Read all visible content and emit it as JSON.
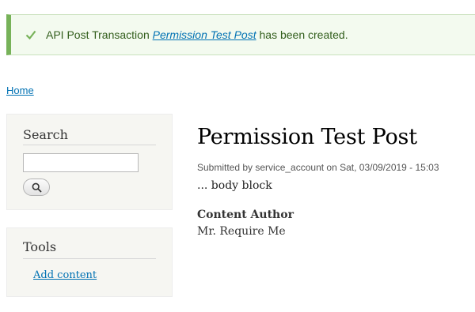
{
  "status": {
    "prefix": "API Post Transaction ",
    "link": "Permission Test Post",
    "suffix": " has been created."
  },
  "breadcrumb": {
    "home": "Home"
  },
  "search_block": {
    "title": "Search",
    "input_value": ""
  },
  "tools_block": {
    "title": "Tools",
    "add_content": "Add content"
  },
  "node": {
    "title": "Permission Test Post",
    "submitted": "Submitted by service_account on Sat, 03/09/2019 - 15:03",
    "body": "... body block",
    "field_label": "Content Author",
    "field_value": "Mr. Require Me"
  },
  "colors": {
    "status_bg": "#f3faef",
    "status_accent": "#77b259",
    "status_text": "#325e1c",
    "link": "#0071b3",
    "sidebar_bg": "#f6f6f2"
  }
}
